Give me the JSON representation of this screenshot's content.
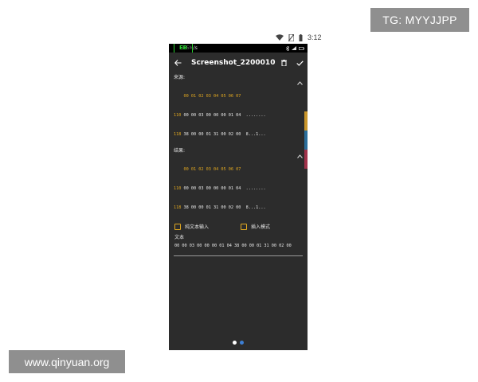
{
  "watermarks": {
    "tg": "TG: MYYJJPP",
    "site": "www.qinyuan.org"
  },
  "outer_status": {
    "time": "3:12"
  },
  "status_bar": {
    "speed": "1.5M/s",
    "logo": "EB"
  },
  "app_bar": {
    "title": "Screenshot_2200010...",
    "icons": [
      "back-arrow-icon",
      "trash-icon",
      "checkmark-icon"
    ]
  },
  "source": {
    "label": "来源:",
    "header": "00 01 02 03 04 05 06 07",
    "rows": [
      {
        "offset": "110",
        "bytes": "00 00 03 00 00 00 01 04",
        "ascii": "........"
      },
      {
        "offset": "118",
        "bytes": "38 00 00 01 31 00 02 00",
        "ascii": "8...1..."
      }
    ]
  },
  "result": {
    "label": "结果:",
    "header": "00 01 02 03 04 05 06 07",
    "rows": [
      {
        "offset": "110",
        "bytes": "00 00 03 00 00 00 01 04",
        "ascii": "........"
      },
      {
        "offset": "118",
        "bytes": "38 00 00 01 31 00 02 00",
        "ascii": "8...1..."
      }
    ]
  },
  "options": {
    "plain_text_input": "纯文本输入",
    "insert_mode": "插入模式"
  },
  "text_field": {
    "label": "文本",
    "value": "00 00 03 00 00 00 01 04 38 00 00 01 31 00 02 00"
  },
  "colors": {
    "accent": "#e0a720",
    "background": "#2c2c2c",
    "side_tabs": [
      "#c8952a",
      "#2a6d9a",
      "#a0324a"
    ]
  }
}
